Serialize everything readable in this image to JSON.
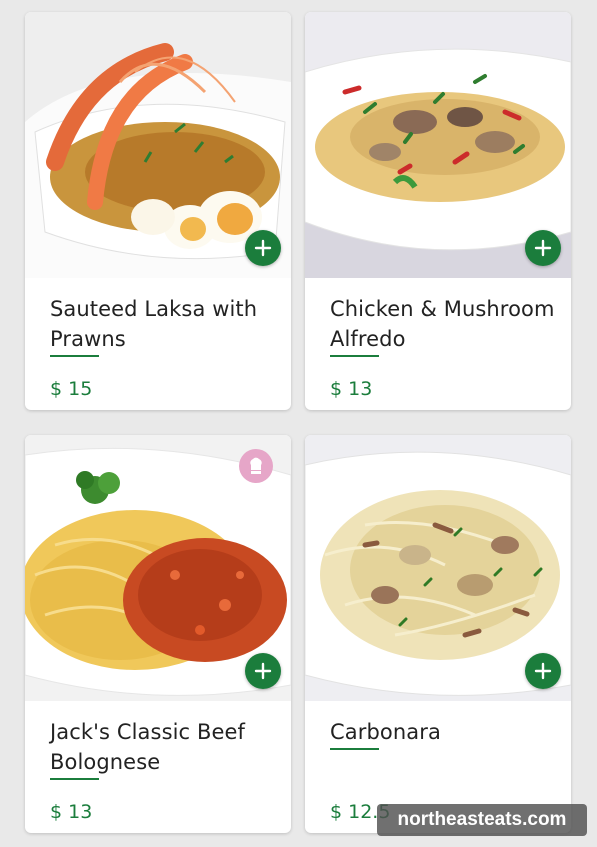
{
  "menu": {
    "items": [
      {
        "name": "Sauteed Laksa with Prawns",
        "price": "$ 15",
        "add_icon": "plus-icon"
      },
      {
        "name": "Chicken & Mushroom Alfredo",
        "price": "$ 13",
        "add_icon": "plus-icon"
      },
      {
        "name": "Jack's Classic Beef Bolognese",
        "price": "$ 13",
        "add_icon": "plus-icon",
        "badge_icon": "chef-hat-icon"
      },
      {
        "name": "Carbonara",
        "price": "$ 12.5",
        "add_icon": "plus-icon"
      }
    ]
  },
  "watermark": {
    "text": "northeasteats.com"
  },
  "colors": {
    "accent": "#1b7d3c",
    "background": "#e9e9e9",
    "card": "#ffffff",
    "chef_badge": "#e6a6c8"
  }
}
